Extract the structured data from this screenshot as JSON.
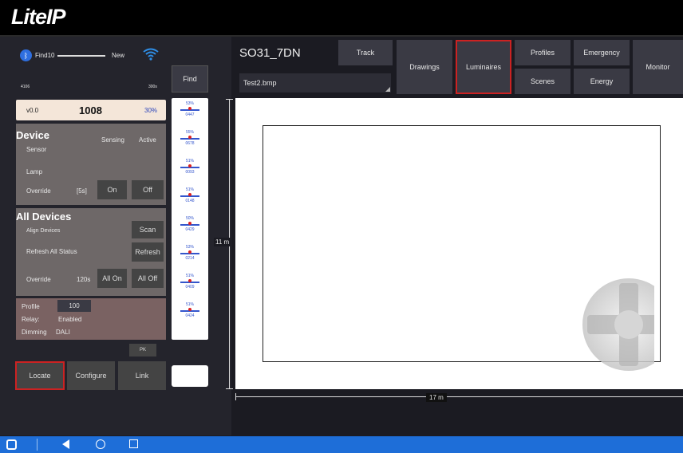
{
  "app": {
    "logo": "LiteIP"
  },
  "connection": {
    "find_label": "Find10",
    "new_label": "New",
    "left_small": "4106",
    "right_small": "300s",
    "find_button": "Find"
  },
  "status": {
    "version": "v0.0",
    "count": "1008",
    "percent": "30%"
  },
  "device": {
    "title": "Device",
    "sensing_label": "Sensing",
    "active_label": "Active",
    "sensor_label": "Sensor",
    "lamp_label": "Lamp",
    "override_label": "Override",
    "override_time": "[5s]",
    "on_button": "On",
    "off_button": "Off"
  },
  "all_devices": {
    "title": "All Devices",
    "align_label": "Align Devices",
    "scan_button": "Scan",
    "refresh_label": "Refresh All Status",
    "refresh_button": "Refresh",
    "override_label": "Override",
    "override_time": "120s",
    "all_on_button": "All On",
    "all_off_button": "All Off"
  },
  "profile": {
    "profile_label": "Profile",
    "profile_value": "100",
    "relay_label": "Relay:",
    "relay_value": "Enabled",
    "dimming_label": "Dimming",
    "dimming_value": "DALI",
    "small_button": "PK"
  },
  "actions": {
    "locate": "Locate",
    "configure": "Configure",
    "link": "Link"
  },
  "sensor_strip": [
    {
      "top": "53%",
      "bottom": "0447"
    },
    {
      "top": "55%",
      "bottom": "0678"
    },
    {
      "top": "51%",
      "bottom": "0093"
    },
    {
      "top": "51%",
      "bottom": "0148"
    },
    {
      "top": "50%",
      "bottom": "0429"
    },
    {
      "top": "53%",
      "bottom": "0214"
    },
    {
      "top": "51%",
      "bottom": "0409"
    },
    {
      "top": "51%",
      "bottom": "0424"
    }
  ],
  "header": {
    "site": "SO31_7DN",
    "file": "Test2.bmp"
  },
  "tabs": {
    "track": "Track",
    "drawings": "Drawings",
    "luminaires": "Luminaires",
    "profiles": "Profiles",
    "emergency": "Emergency",
    "scenes": "Scenes",
    "energy": "Energy",
    "monitor": "Monitor"
  },
  "plan": {
    "height_label": "11 m",
    "width_label": "17 m"
  },
  "colors": {
    "highlight": "#cc2222",
    "navbar": "#1e6ed8",
    "accent": "#3355cc"
  }
}
